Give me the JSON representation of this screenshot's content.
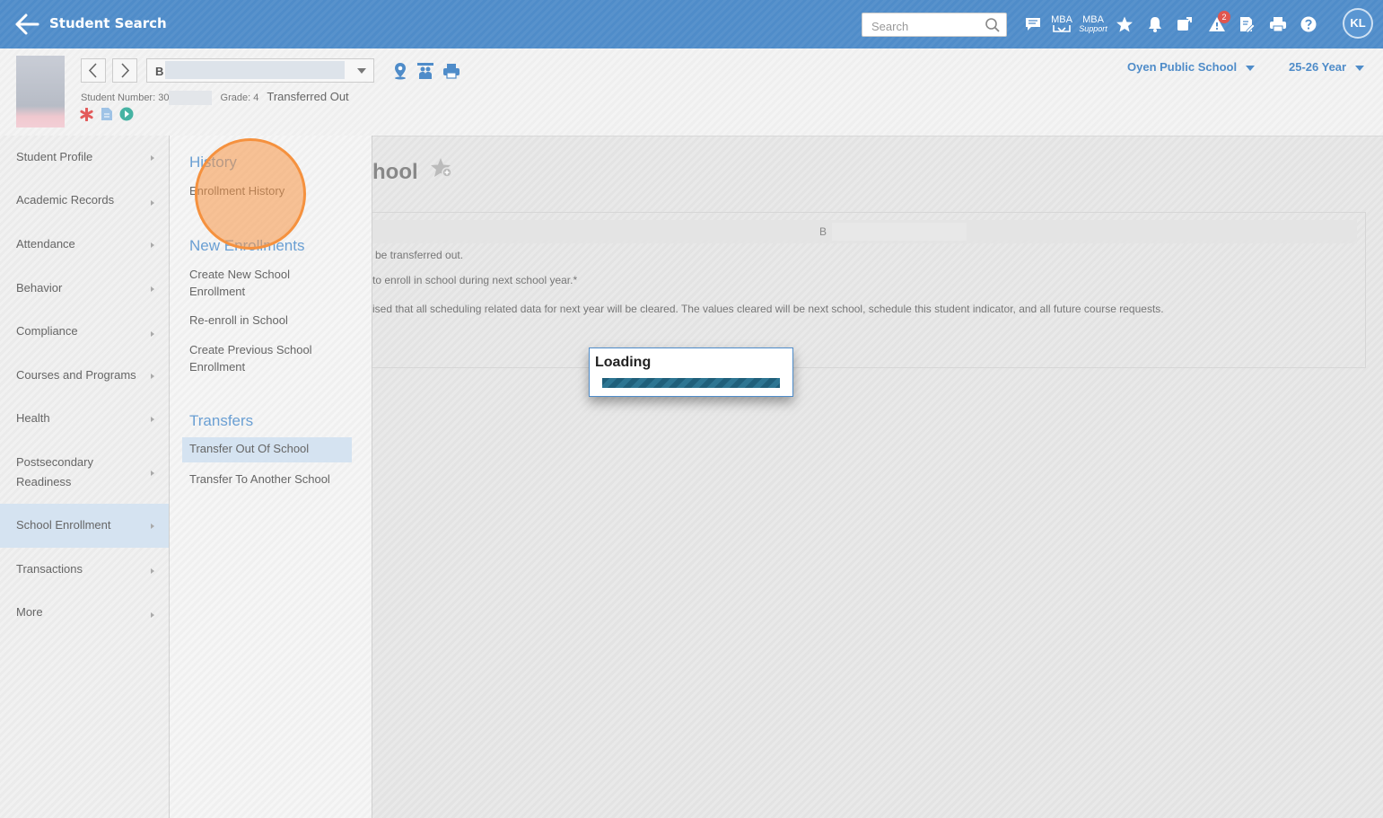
{
  "topbar": {
    "title": "Student Search",
    "search_placeholder": "Search",
    "mba_label": "MBA",
    "mba_support_label1": "MBA",
    "mba_support_label2": "Support",
    "notification_count": "2",
    "user_initials": "KL"
  },
  "student": {
    "name_visible": "B",
    "number_label": "Student Number: 30",
    "grade_label": "Grade: 4",
    "status": "Transferred Out"
  },
  "context": {
    "school": "Oyen Public School",
    "year": "25-26 Year"
  },
  "nav": {
    "items": [
      {
        "label": "Student Profile"
      },
      {
        "label": "Academic Records"
      },
      {
        "label": "Attendance"
      },
      {
        "label": "Behavior"
      },
      {
        "label": "Compliance"
      },
      {
        "label": "Courses and Programs"
      },
      {
        "label": "Health"
      },
      {
        "label": "Postsecondary Readiness"
      },
      {
        "label": "School Enrollment"
      },
      {
        "label": "Transactions"
      },
      {
        "label": "More"
      }
    ],
    "active": "School Enrollment"
  },
  "submenu": {
    "history_heading": "History",
    "enrollment_history": "Enrollment History",
    "new_enrollments_heading": "New Enrollments",
    "create_new": "Create New School Enrollment",
    "reenroll": "Re-enroll in School",
    "create_previous": "Create Previous School Enrollment",
    "transfers_heading": "Transfers",
    "transfer_out": "Transfer Out Of School",
    "transfer_to": "Transfer To Another School"
  },
  "main": {
    "title_fragment": "hool",
    "header_fragment": "B",
    "line1": "be transferred out.",
    "line2": "to enroll in school during next school year.*",
    "line3": "ised that all scheduling related data for next year will be cleared. The values cleared will be next school, schedule this student indicator, and all future course requests."
  },
  "loading": {
    "title": "Loading"
  },
  "colors": {
    "topbar": "#4f8cc9",
    "accent": "#6a9fd3",
    "active_bg": "#d5e3f1",
    "click_highlight": "#f5913e"
  }
}
